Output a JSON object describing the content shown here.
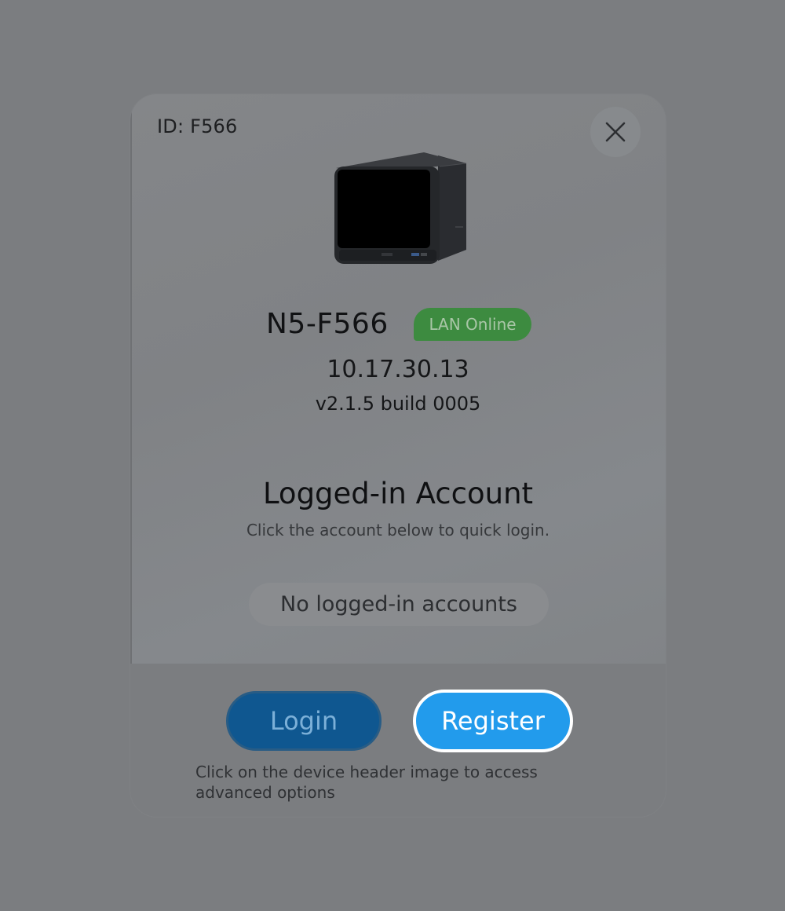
{
  "dialog": {
    "device_id_label": "ID: F566",
    "close_icon": "close-icon",
    "device_image_icon": "nas-device-image",
    "device_name": "N5-F566",
    "status_badge": "LAN Online",
    "ip_address": "10.17.30.13",
    "firmware_version": "v2.1.5 build 0005",
    "section_title": "Logged-in Account",
    "section_subtitle": "Click the account below to quick login.",
    "empty_accounts_text": "No logged-in accounts",
    "login_label": "Login",
    "register_label": "Register",
    "hint_text": "Click on the device header image to access advanced options"
  },
  "colors": {
    "overlay": "#7b7d80",
    "status_online": "#3d8b40",
    "login_button": "#0f5790",
    "register_button": "#229bec",
    "register_border": "#ffffff"
  }
}
